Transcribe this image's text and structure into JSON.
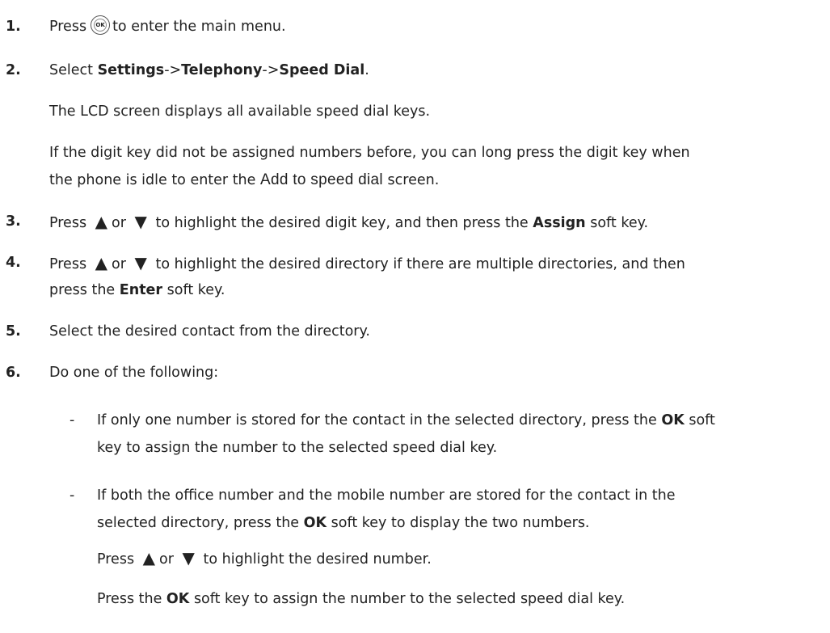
{
  "steps": [
    {
      "number": "1.",
      "press": "Press",
      "ok_label": "OK",
      "after": "to enter the main menu."
    },
    {
      "number": "2.",
      "select": "Select",
      "settings": "Settings",
      "sep1": "->",
      "telephony": "Telephony",
      "sep2": "->",
      "speed_dial": "Speed Dial",
      "end": "."
    },
    {
      "para1": "The LCD screen displays all available speed dial keys.",
      "para2_line1": "If the digit key did not be assigned numbers before, you can long press the digit key when",
      "para2_line2a": "the phone is idle to enter the",
      "lcd_text": "Add to speed dial",
      "para2_line2b": "screen."
    },
    {
      "number": "3.",
      "press": "Press",
      "up": "▲",
      "or": "or",
      "down": "▼",
      "mid": "to highlight the desired digit key, and then press the",
      "key": "Assign",
      "end": "soft key."
    },
    {
      "number": "4.",
      "press": "Press",
      "up": "▲",
      "or": "or",
      "down": "▼",
      "mid": "to highlight the desired directory if there are multiple directories, and then",
      "line2a": "press the",
      "key": "Enter",
      "end": "soft key."
    },
    {
      "number": "5.",
      "text": "Select the desired contact from the directory."
    },
    {
      "number": "6.",
      "text": "Do one of the following:"
    }
  ],
  "bullets": [
    {
      "dash": "-",
      "line1a": "If only one number is stored for the contact in the selected directory, press the",
      "key": "OK",
      "line1b": "soft",
      "line2": "key to assign the number to the selected speed dial key."
    },
    {
      "dash": "-",
      "line1": "If both the office number and the mobile number are stored for the contact in the",
      "line2a": "selected directory, press the",
      "key": "OK",
      "line2b": "soft key to display the two numbers.",
      "press": "Press",
      "up": "▲",
      "or": "or",
      "down": "▼",
      "line3b": "to highlight the desired number.",
      "line4a": "Press the",
      "key2": "OK",
      "line4b": "soft key to assign the number to the selected speed dial key."
    }
  ]
}
